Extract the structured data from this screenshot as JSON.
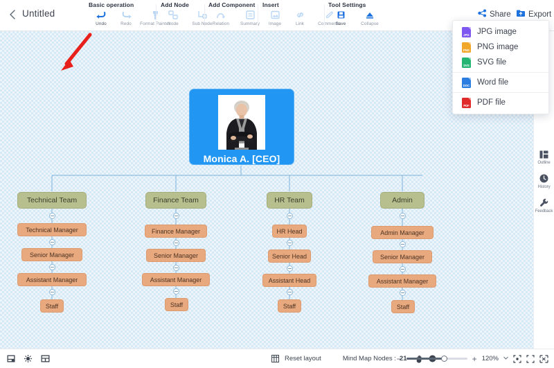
{
  "header": {
    "back_icon": "chevron-left-icon",
    "title": "Untitled",
    "share_label": "Share",
    "export_label": "Export",
    "share_icon": "share-nodes-icon",
    "export_icon": "export-folder-icon"
  },
  "toolbar": {
    "groups": [
      {
        "title": "Basic operation",
        "items": [
          {
            "label": "Undo",
            "icon": "undo-arrow-icon",
            "enabled": true
          },
          {
            "label": "Redo",
            "icon": "redo-arrow-icon",
            "enabled": false
          },
          {
            "label": "Format Painter",
            "icon": "format-painter-icon",
            "enabled": false
          }
        ]
      },
      {
        "title": "Add Node",
        "items": [
          {
            "label": "Node",
            "icon": "add-node-icon",
            "enabled": false
          },
          {
            "label": "Sub Node",
            "icon": "add-sub-node-icon",
            "enabled": false
          }
        ]
      },
      {
        "title": "Add Component",
        "items": [
          {
            "label": "Relation",
            "icon": "relation-arrow-icon",
            "enabled": false
          },
          {
            "label": "Summary",
            "icon": "summary-bracket-icon",
            "enabled": false
          }
        ]
      },
      {
        "title": "Insert",
        "items": [
          {
            "label": "Image",
            "icon": "image-icon",
            "enabled": false
          },
          {
            "label": "Link",
            "icon": "link-icon",
            "enabled": false
          },
          {
            "label": "Comments",
            "icon": "comment-pen-icon",
            "enabled": false
          }
        ]
      },
      {
        "title": "Tool Settings",
        "items": [
          {
            "label": "Save",
            "icon": "save-disk-icon",
            "enabled": true
          },
          {
            "label": "Collapse",
            "icon": "collapse-up-icon",
            "enabled": true
          }
        ]
      }
    ]
  },
  "export_menu": {
    "items": [
      {
        "label": "JPG image",
        "icon": "jpg-file-icon",
        "badge": "JPG",
        "color": "#7e57f0"
      },
      {
        "label": "PNG image",
        "icon": "png-file-icon",
        "badge": "PNG",
        "color": "#f0a72a"
      },
      {
        "label": "SVG file",
        "icon": "svg-file-icon",
        "badge": "SVG",
        "color": "#24b573"
      },
      {
        "label": "Word file",
        "icon": "word-file-icon",
        "badge": "DOC",
        "color": "#2b7ee0"
      },
      {
        "label": "PDF file",
        "icon": "pdf-file-icon",
        "badge": "PDF",
        "color": "#e02b2b"
      }
    ]
  },
  "sidebar": {
    "items": [
      {
        "label": "Outline",
        "icon": "outline-icon"
      },
      {
        "label": "History",
        "icon": "clock-history-icon"
      },
      {
        "label": "Feedback",
        "icon": "wrench-feedback-icon"
      }
    ]
  },
  "statusbar": {
    "left_icons": [
      {
        "icon": "fit-screen-icon"
      },
      {
        "icon": "theme-color-icon"
      },
      {
        "icon": "layout-icon"
      }
    ],
    "reset_layout_label": "Reset layout",
    "reset_layout_icon": "reset-layout-icon",
    "node_count_label": "Mind Map Nodes :",
    "node_count": "21",
    "hand_icon": "hand-tool-icon",
    "pointer_icon": "pointer-tool-icon",
    "zoom_minus": "−",
    "zoom_plus": "+",
    "zoom_level": "120%",
    "zoom_caret_icon": "chevron-down-icon",
    "zoom_center_icon": "center-focus-icon",
    "zoom_fit_icon": "fit-bounds-icon",
    "zoom_fullscreen_icon": "fullscreen-icon"
  },
  "mindmap": {
    "root": {
      "label": "Monica A. [CEO]",
      "photo_alt": "photo-of-ceo",
      "color": "#2196f3"
    },
    "team_color": "#b8bf8e",
    "role_color": "#e9a97f",
    "branches": [
      {
        "team": "Technical Team",
        "roles": [
          "Technical Manager",
          "Senior Manager",
          "Assistant Manager",
          "Staff"
        ]
      },
      {
        "team": "Finance Team",
        "roles": [
          "Finance Manager",
          "Senior Manager",
          "Assistant Manager",
          "Staff"
        ]
      },
      {
        "team": "HR Team",
        "roles": [
          "HR Head",
          "Senior Head",
          "Assistant Head",
          "Staff"
        ]
      },
      {
        "team": "Admin",
        "roles": [
          "Admin Manager",
          "Senior Manager",
          "Assistant Manager",
          "Staff"
        ]
      }
    ]
  },
  "annotations": {
    "arrow_color": "#e8201c",
    "arrows": [
      {
        "name": "arrow-pointing-to-toolbar"
      },
      {
        "name": "arrow-pointing-to-export"
      }
    ]
  }
}
